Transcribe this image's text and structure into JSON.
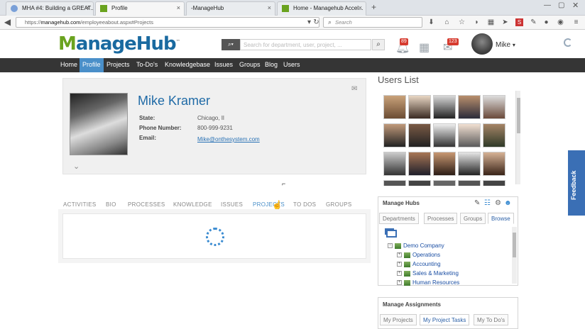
{
  "browser": {
    "tabs": [
      {
        "label": "MHA #4: Building a GREAT...",
        "close": "×"
      },
      {
        "label": "Profile",
        "close": "×"
      },
      {
        "label": "-ManageHub",
        "close": "×"
      },
      {
        "label": "Home - Managehub Accel...",
        "close": "×"
      }
    ],
    "new_tab": "+",
    "url_prefix": "https://",
    "url_domain": "managehub.com",
    "url_path": "/employeeabout.aspx#Projects",
    "search_placeholder": "Search"
  },
  "header": {
    "logo_m": "M",
    "logo_rest": "anageHub",
    "logo_tm": "™",
    "search_placeholder": "Search for department, user, project, ...",
    "notifications_count": "89",
    "messages_count": "123",
    "user_name": "Mike",
    "user_caret": "▾"
  },
  "menu": [
    "Home",
    "Profile",
    "Projects",
    "To-Do's",
    "Knowledgebase",
    "Issues",
    "Groups",
    "Blog",
    "Users"
  ],
  "profile": {
    "name": "Mike Kramer",
    "state_label": "State:",
    "state_value": "Chicago, Il",
    "phone_label": "Phone Number:",
    "phone_value": "800-999-9231",
    "email_label": "Email:",
    "email_value": "Mike@onthesystem.com"
  },
  "profile_tabs": [
    "ACTIVITIES",
    "BIO",
    "PROCESSES",
    "KNOWLEDGE",
    "ISSUES",
    "PROJECTS",
    "TO DOS",
    "GROUPS"
  ],
  "users_list": {
    "title": "Users List"
  },
  "manage_hubs": {
    "title": "Manage  Hubs",
    "tabs": [
      "Departments",
      "Processes",
      "Groups",
      "Browse"
    ],
    "tree_root": "Demo Company",
    "tree_children": [
      "Operations",
      "Accounting",
      "Sales & Marketing",
      "Human Resources"
    ]
  },
  "manage_assignments": {
    "title": "Manage  Assignments",
    "tabs": [
      "My Projects",
      "My Project Tasks",
      "My To Do's"
    ]
  },
  "feedback": "Feedback",
  "colors": {
    "accent": "#4a8fc9",
    "logo_green": "#6aa31f",
    "logo_blue": "#1a6aa0",
    "menu_bg": "#353535",
    "badge": "#d63b2f"
  }
}
